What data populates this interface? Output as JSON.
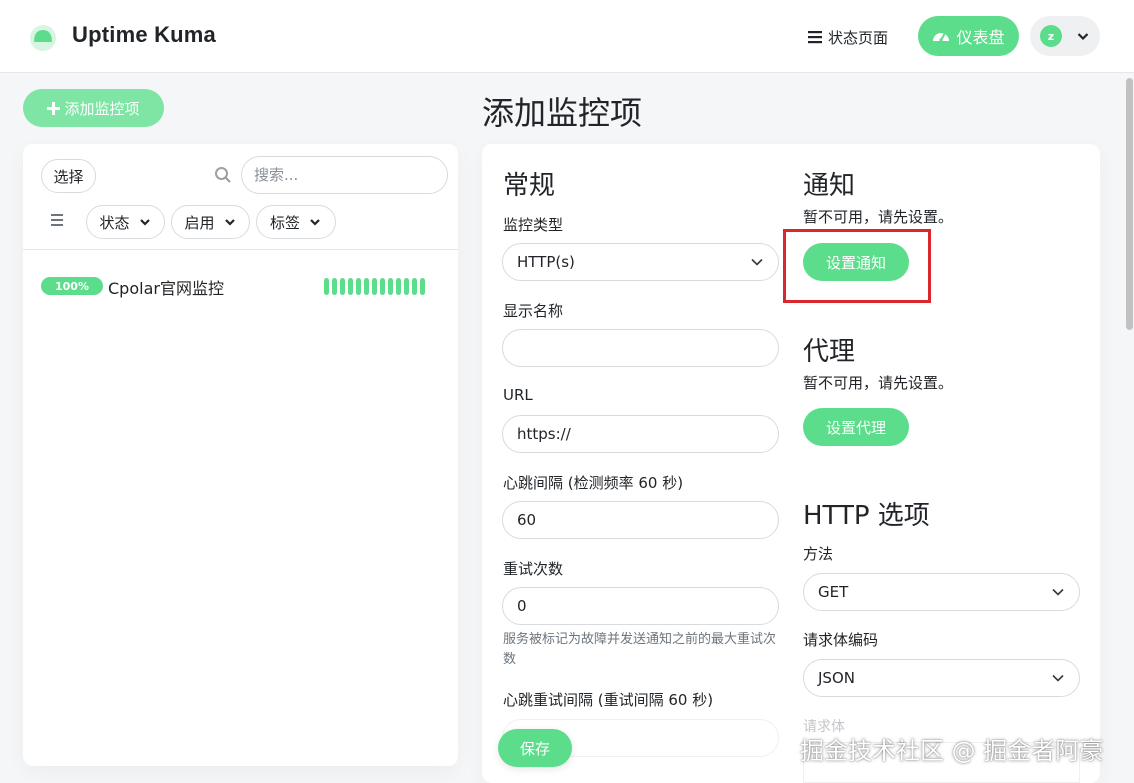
{
  "header": {
    "app_title": "Uptime Kuma",
    "status_page_label": "状态页面",
    "dashboard_label": "仪表盘",
    "avatar_letter": "z"
  },
  "sidebar": {
    "add_monitor_label": "添加监控项",
    "select_label": "选择",
    "search_placeholder": "搜索...",
    "filters": [
      {
        "label": "状态"
      },
      {
        "label": "启用"
      },
      {
        "label": "标签"
      }
    ],
    "monitors": [
      {
        "uptime": "100%",
        "name": "Cpolar官网监控",
        "heartbeats": 13
      }
    ]
  },
  "main": {
    "page_title": "添加监控项",
    "general": {
      "section_title": "常规",
      "monitor_type_label": "监控类型",
      "monitor_type_value": "HTTP(s)",
      "friendly_name_label": "显示名称",
      "friendly_name_value": "",
      "url_label": "URL",
      "url_value": "https://",
      "interval_label": "心跳间隔 (检测频率 60 秒)",
      "interval_value": "60",
      "retries_label": "重试次数",
      "retries_value": "0",
      "retries_help": "服务被标记为故障并发送通知之前的最大重试次数",
      "retry_interval_label": "心跳重试间隔 (重试间隔 60 秒)"
    },
    "notification": {
      "section_title": "通知",
      "hint": "暂不可用，请先设置。",
      "setup_label": "设置通知"
    },
    "proxy": {
      "section_title": "代理",
      "hint": "暂不可用，请先设置。",
      "setup_label": "设置代理"
    },
    "http_options": {
      "section_title": "HTTP 选项",
      "method_label": "方法",
      "method_value": "GET",
      "body_encoding_label": "请求体编码",
      "body_encoding_value": "JSON",
      "body_label": "请求体"
    },
    "save_label": "保存"
  },
  "watermark": "掘金技术社区 @ 掘金者阿豪",
  "colors": {
    "accent": "#5cdd8b",
    "highlight": "#d9272e"
  }
}
